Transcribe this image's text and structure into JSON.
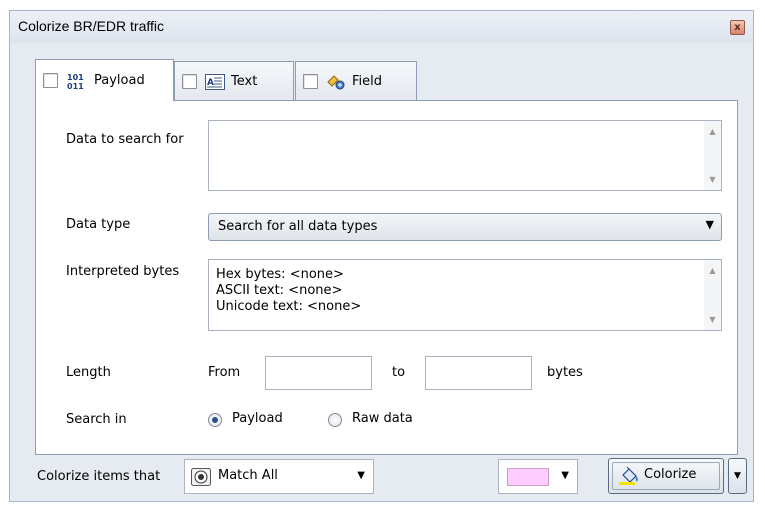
{
  "window": {
    "title": "Colorize BR/EDR traffic",
    "close_glyph": "x"
  },
  "tabs": [
    {
      "label": "Payload",
      "icon": "binary-icon",
      "checked": false
    },
    {
      "label": "Text",
      "icon": "text-icon",
      "checked": false
    },
    {
      "label": "Field",
      "icon": "field-icon",
      "checked": false
    }
  ],
  "form": {
    "data_to_search_label": "Data to search for",
    "data_to_search_value": "",
    "data_type_label": "Data type",
    "data_type_value": "Search for all data types",
    "interpreted_label": "Interpreted bytes",
    "interpreted_lines": [
      "Hex bytes: <none>",
      "ASCII text: <none>",
      "Unicode text: <none>"
    ],
    "length_label": "Length",
    "from_label": "From",
    "from_value": "",
    "to_label": "to",
    "to_value": "",
    "bytes_label": "bytes",
    "search_in_label": "Search in",
    "search_in_options": [
      "Payload",
      "Raw data"
    ],
    "search_in_selected": "Payload"
  },
  "footer": {
    "colorize_items_label": "Colorize items that",
    "match_value": "Match All",
    "match_icon": "match-all-icon",
    "color_value": "#ffccff",
    "colorize_button_label": "Colorize"
  },
  "colors": {
    "dialog_bg": "#e6ebf2",
    "border": "#8e9db2",
    "accent": "#2a4f85"
  }
}
